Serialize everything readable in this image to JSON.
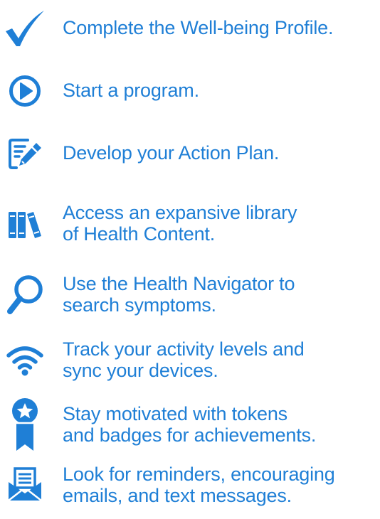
{
  "accent_color": "#1f7fd6",
  "items": [
    {
      "icon": "checkmark-icon",
      "text": "Complete the Well-being Profile."
    },
    {
      "icon": "play-circle-icon",
      "text": "Start a program."
    },
    {
      "icon": "edit-notepad-icon",
      "text": "Develop your Action Plan."
    },
    {
      "icon": "books-library-icon",
      "text": "Access an expansive library\nof Health Content."
    },
    {
      "icon": "magnifier-icon",
      "text": "Use the Health Navigator to\nsearch symptoms."
    },
    {
      "icon": "wifi-signal-icon",
      "text": "Track your activity levels and\nsync your devices."
    },
    {
      "icon": "award-ribbon-icon",
      "text": "Stay motivated with tokens\nand badges for achievements."
    },
    {
      "icon": "envelope-message-icon",
      "text": "Look for reminders, encouraging\nemails, and text messages."
    }
  ]
}
